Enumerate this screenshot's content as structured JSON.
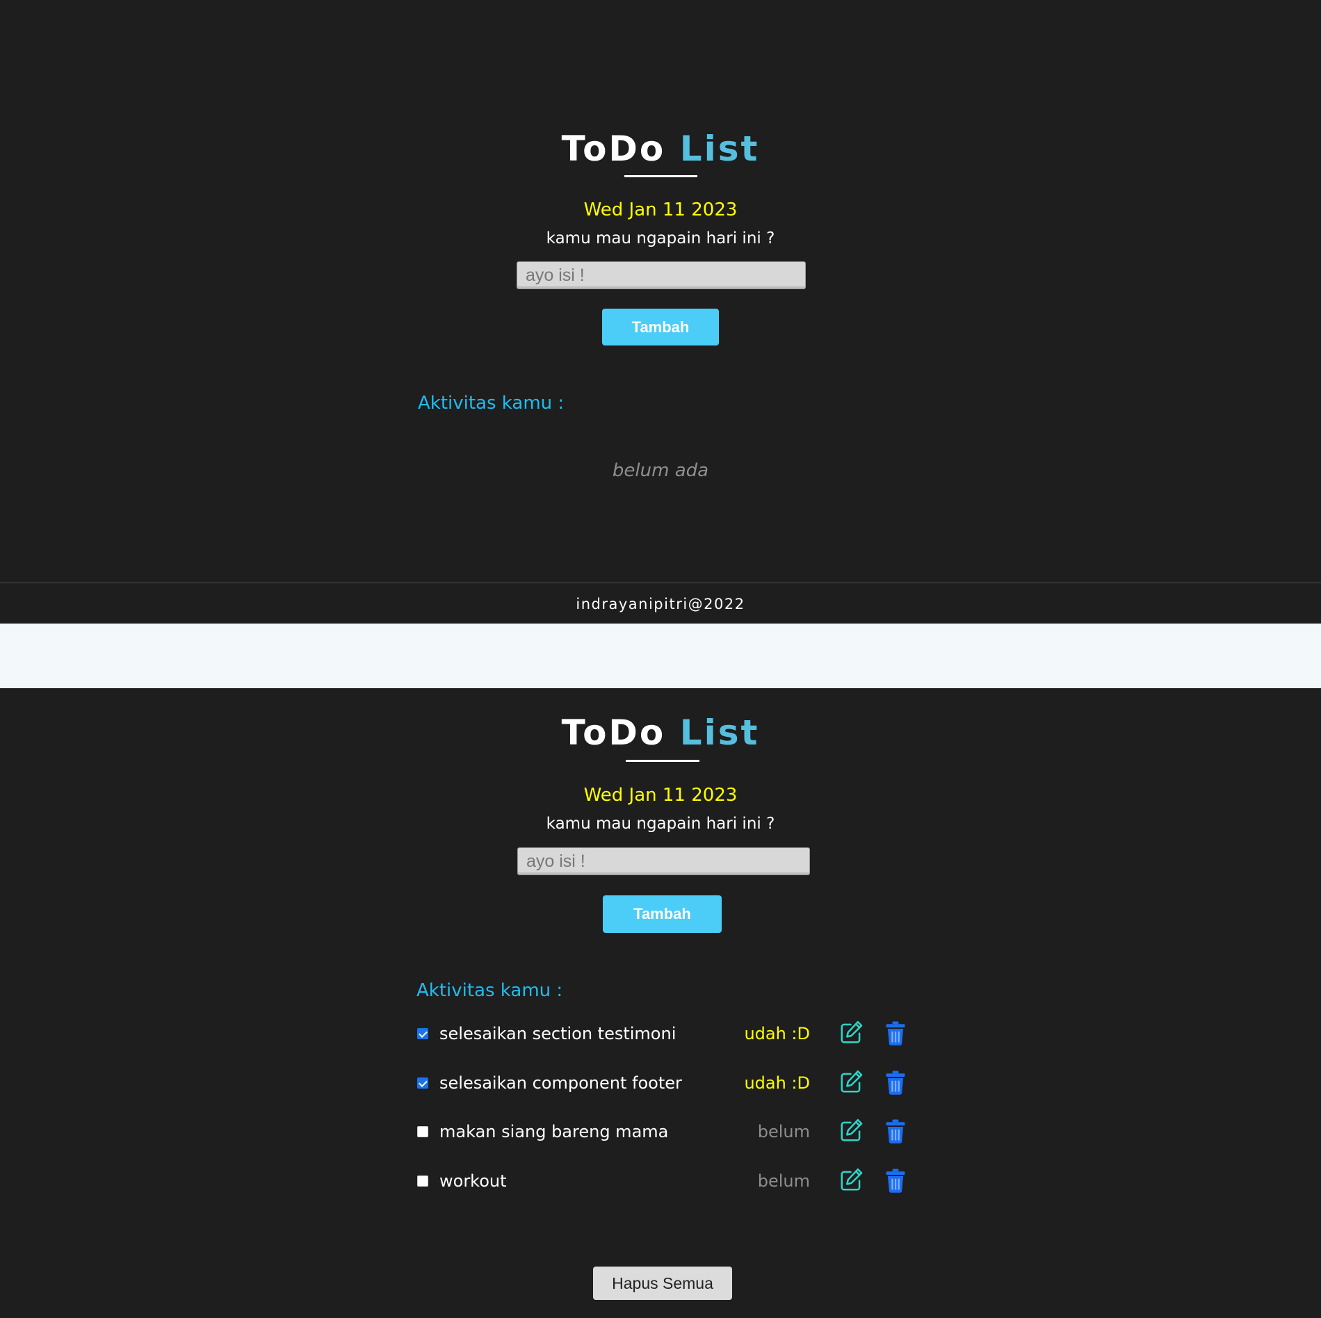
{
  "app": {
    "title_part1": "ToDo",
    "title_part2": "List",
    "date": "Wed Jan 11 2023",
    "question": "kamu mau ngapain hari ini ?",
    "input_placeholder": "ayo isi !",
    "add_button_label": "Tambah",
    "section_title": "Aktivitas kamu :",
    "accent_color": "#4ccdf7"
  },
  "empty_view": {
    "empty_message": "belum ada",
    "footer_text": "indrayanipitri@2022"
  },
  "list_view": {
    "tasks": [
      {
        "text": "selesaikan section testimoni",
        "done": true,
        "status": "udah :D"
      },
      {
        "text": "selesaikan component footer",
        "done": true,
        "status": "udah :D"
      },
      {
        "text": "makan siang bareng mama",
        "done": false,
        "status": "belum"
      },
      {
        "text": "workout",
        "done": false,
        "status": "belum"
      }
    ],
    "clear_all_label": "Hapus Semua"
  }
}
